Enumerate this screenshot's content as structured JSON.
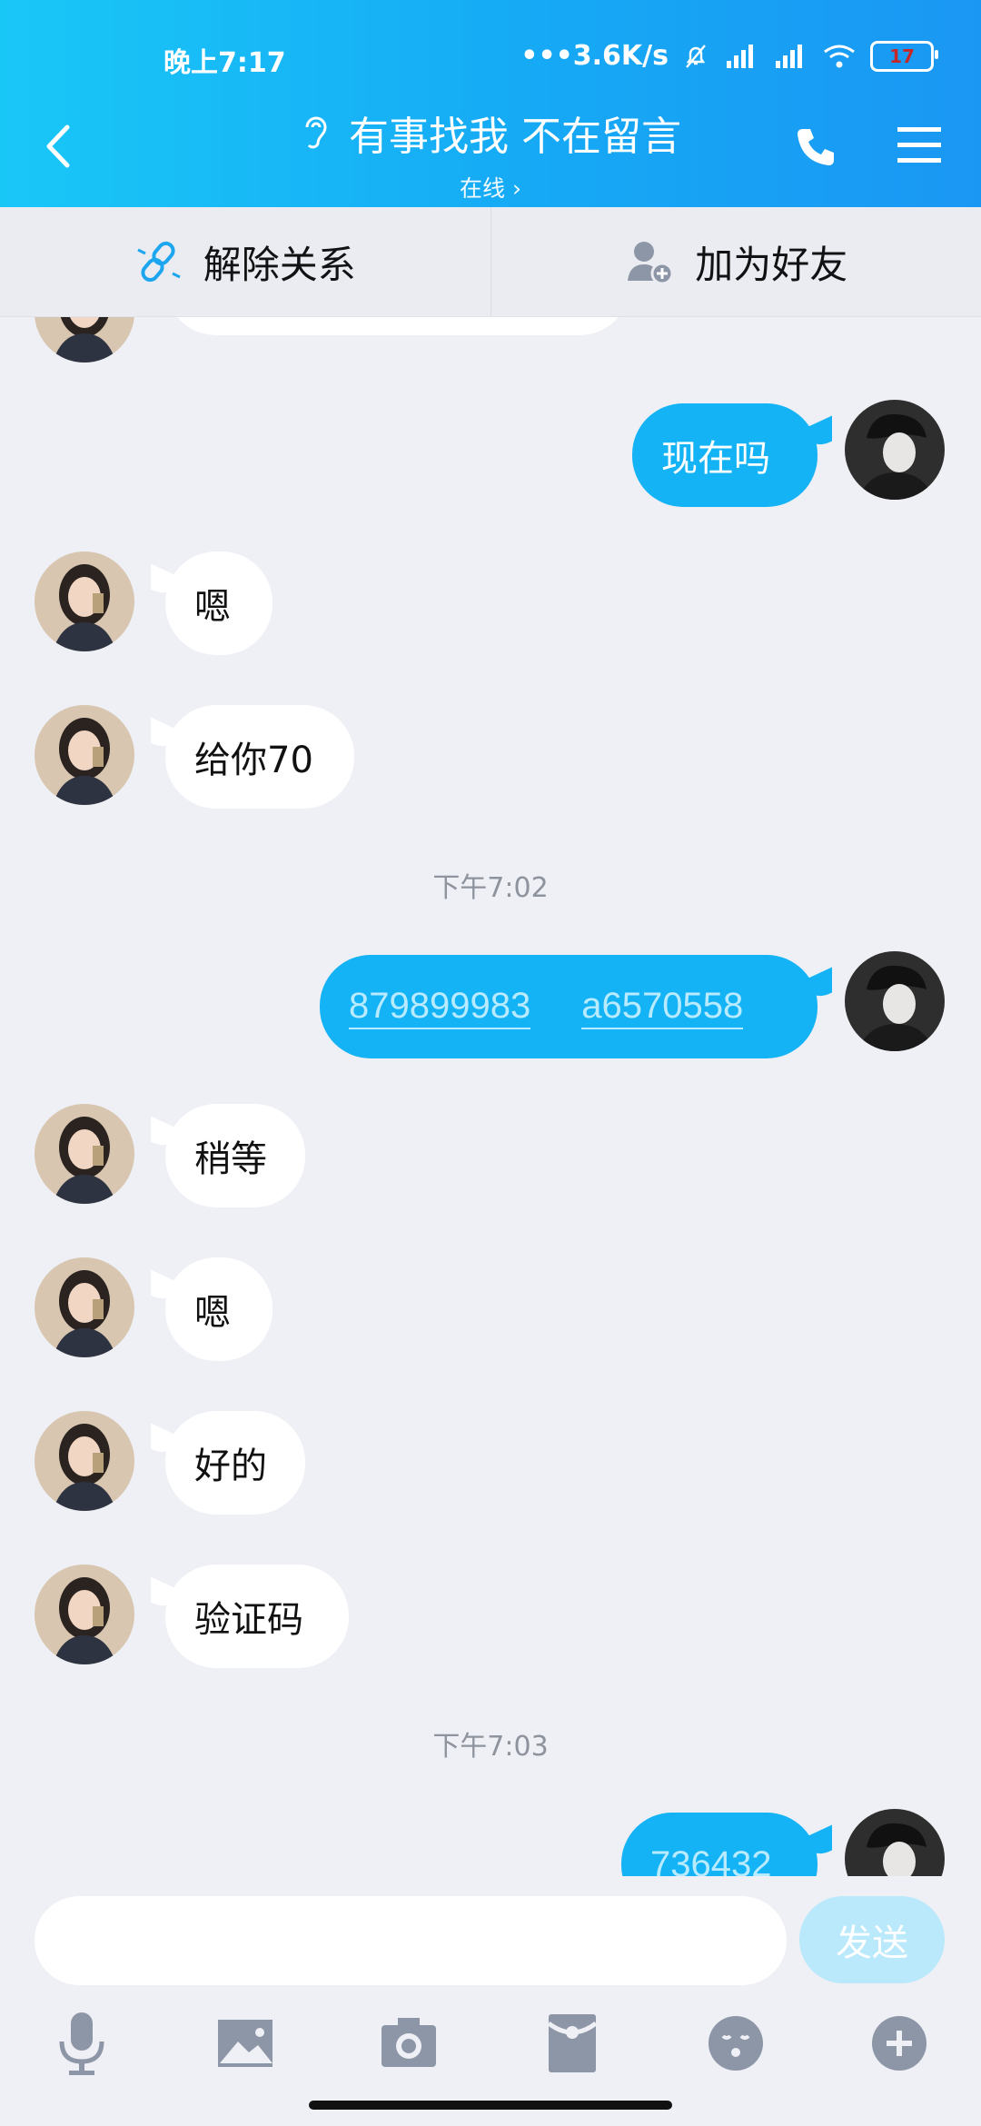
{
  "status": {
    "time": "晚上7:17",
    "network": "•••3.6K/s",
    "battery": "17"
  },
  "nav": {
    "title": "有事找我 不在留言",
    "subtitle": "在线 ›"
  },
  "toolbar": {
    "unlink": "解除关系",
    "add_friend": "加为好友"
  },
  "messages": {
    "m1": "现在吗",
    "m2": "嗯",
    "m3": "给你70",
    "t1": "下午7:02",
    "m4a": "879899983",
    "m4b": "a6570558",
    "m5": "稍等",
    "m6": "嗯",
    "m7": "好的",
    "m8": "验证码",
    "t2": "下午7:03",
    "m9": "736432"
  },
  "bottom": {
    "send": "发送"
  },
  "colors": {
    "accent": "#14b3f5",
    "header": "#16a9f5"
  }
}
